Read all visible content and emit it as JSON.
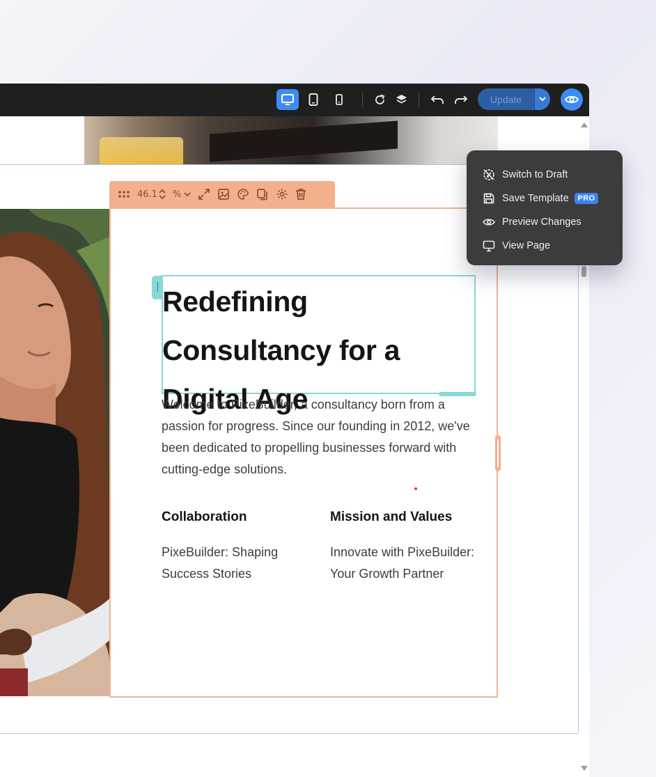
{
  "toolbar": {
    "update_label": "Update",
    "devices": [
      "desktop-icon",
      "tablet-icon",
      "mobile-icon"
    ],
    "active_device": "desktop",
    "accent_color": "#3d8bf5"
  },
  "column_toolbar": {
    "width_value": "46.1",
    "unit": "%"
  },
  "dropdown": {
    "items": [
      {
        "label": "Switch to Draft",
        "icon": "draft-icon"
      },
      {
        "label": "Save Template",
        "icon": "save-icon",
        "badge": "PRO"
      },
      {
        "label": "Preview Changes",
        "icon": "eye-icon"
      },
      {
        "label": "View Page",
        "icon": "monitor-icon"
      }
    ]
  },
  "content": {
    "heading": "Redefining Consultancy for a Digital Age",
    "intro": "Welcome to PixeBuilder, a consultancy born from a passion for progress. Since our founding in 2012, we've been dedicated to propelling businesses forward with cutting-edge solutions.",
    "features": [
      {
        "title": "Collaboration",
        "text": "PixeBuilder: Shaping Success Stories"
      },
      {
        "title": "Mission and Values",
        "text": "Innovate with PixeBuilder: Your Growth Partner"
      }
    ]
  }
}
